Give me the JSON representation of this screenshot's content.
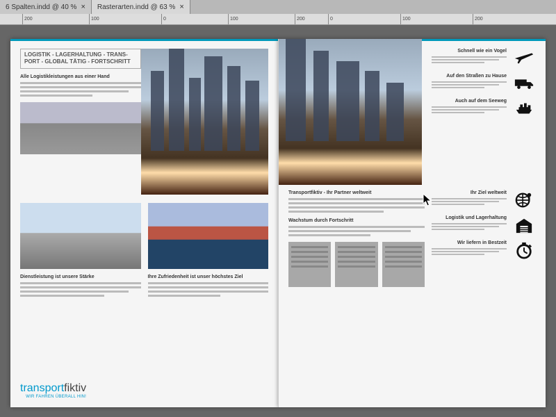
{
  "tabs": [
    {
      "label": "6 Spalten.indd @ 40 %"
    },
    {
      "label": "Rasterarten.indd @ 63 %"
    }
  ],
  "ruler_marks": [
    "200",
    "100",
    "0",
    "100",
    "200",
    "0",
    "100",
    "200"
  ],
  "left_page": {
    "box_title": "LOGISTIK - LAGERHALTUNG - TRANS-PORT - GLOBAL TÄTIG - FORTSCHRITT",
    "h1": "Alle Logistikleistungen aus einer Hand",
    "h2": "Dienstleistung ist unsere Stärke",
    "h3": "Ihre Zufriedenheit ist unser höchstes Ziel",
    "logo_a": "transport",
    "logo_b": "fiktiv",
    "logo_tag_pre": "WIR FAHREN ",
    "logo_tag_em": "ÜBERALL HIN!"
  },
  "right_page": {
    "features_top": [
      {
        "heading": "Schnell wie ein Vogel",
        "icon": "airplane-icon"
      },
      {
        "heading": "Auf den Straßen zu Hause",
        "icon": "truck-icon"
      },
      {
        "heading": "Auch auf dem Seeweg",
        "icon": "ship-icon"
      }
    ],
    "mid_h1": "Transportfiktiv - Ihr Partner weltweit",
    "mid_h2": "Wachstum durch Fortschritt",
    "features_side": [
      {
        "heading": "Ihr Ziel weltweit",
        "icon": "globe-icon"
      },
      {
        "heading": "Logistik und Lagerhaltung",
        "icon": "warehouse-icon"
      },
      {
        "heading": "Wir liefern in Bestzeit",
        "icon": "stopwatch-icon"
      }
    ]
  }
}
